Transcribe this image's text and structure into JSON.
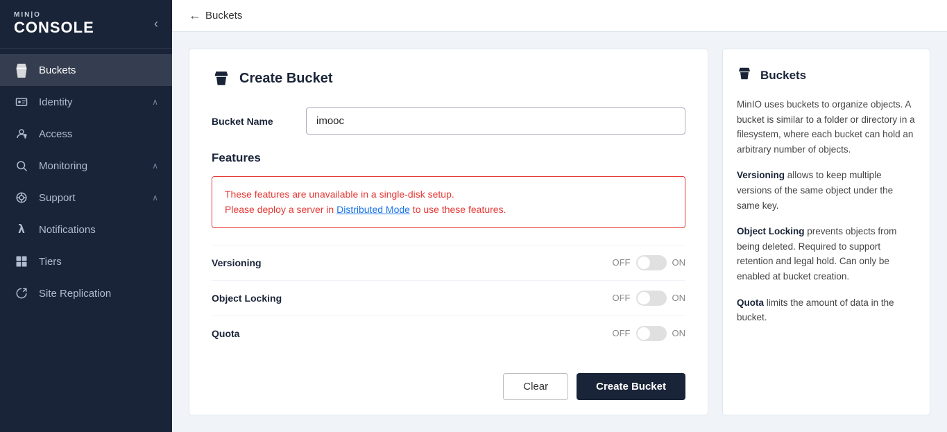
{
  "sidebar": {
    "logo_mini": "MIN|O",
    "logo_console": "CONSOLE",
    "toggle_icon": "‹",
    "items": [
      {
        "id": "buckets",
        "label": "Buckets",
        "icon": "🪣",
        "active": true,
        "has_arrow": false
      },
      {
        "id": "identity",
        "label": "Identity",
        "icon": "🪪",
        "active": false,
        "has_arrow": true
      },
      {
        "id": "access",
        "label": "Access",
        "icon": "🔒",
        "active": false,
        "has_arrow": false
      },
      {
        "id": "monitoring",
        "label": "Monitoring",
        "icon": "🔍",
        "active": false,
        "has_arrow": true
      },
      {
        "id": "support",
        "label": "Support",
        "icon": "⚙",
        "active": false,
        "has_arrow": true
      },
      {
        "id": "notifications",
        "label": "Notifications",
        "icon": "λ",
        "active": false,
        "has_arrow": false
      },
      {
        "id": "tiers",
        "label": "Tiers",
        "icon": "⊞",
        "active": false,
        "has_arrow": false
      },
      {
        "id": "site-replication",
        "label": "Site Replication",
        "icon": "↻",
        "active": false,
        "has_arrow": false
      }
    ]
  },
  "topbar": {
    "back_arrow": "←",
    "back_label": "Buckets"
  },
  "form": {
    "card_title": "Create Bucket",
    "bucket_name_label": "Bucket Name",
    "bucket_name_value": "imooc",
    "features_title": "Features",
    "warning_line1": "These features are unavailable in a single-disk setup.",
    "warning_line2": "Please deploy a server in ",
    "warning_link": "Distributed Mode",
    "warning_line3": " to use these features.",
    "features": [
      {
        "name": "Versioning",
        "off_label": "OFF",
        "on_label": "ON"
      },
      {
        "name": "Object Locking",
        "off_label": "OFF",
        "on_label": "ON"
      },
      {
        "name": "Quota",
        "off_label": "OFF",
        "on_label": "ON"
      }
    ],
    "clear_btn": "Clear",
    "create_btn": "Create Bucket"
  },
  "info": {
    "title": "Buckets",
    "paragraphs": [
      "MinIO uses buckets to organize objects. A bucket is similar to a folder or directory in a filesystem, where each bucket can hold an arbitrary number of objects.",
      "Versioning allows to keep multiple versions of the same object under the same key.",
      "Object Locking prevents objects from being deleted. Required to support retention and legal hold. Can only be enabled at bucket creation.",
      "Quota limits the amount of data in the bucket."
    ],
    "bold_words": [
      "Versioning",
      "Object Locking",
      "Quota"
    ]
  }
}
